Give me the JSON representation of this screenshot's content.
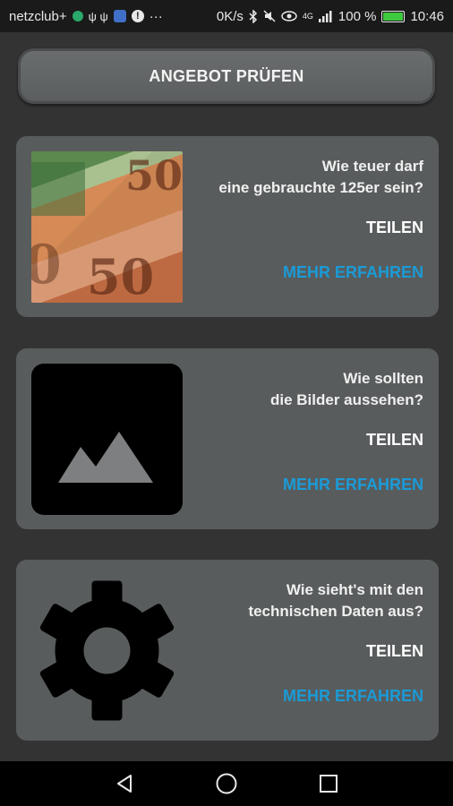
{
  "status_bar": {
    "carrier": "netzclub+",
    "usb_glyphs": "ψ ψ",
    "more": "···",
    "speed": "0K/s",
    "signal_text": "4G",
    "battery": "100 %",
    "battery_level": 1.0,
    "time": "10:46"
  },
  "check_button": {
    "label": "ANGEBOT PRÜFEN"
  },
  "cards": [
    {
      "question": "Wie teuer darf\neine gebrauchte 125er sein?",
      "share": "TEILEN",
      "more": "MEHR ERFAHREN",
      "media_icon": "money-photo"
    },
    {
      "question": "Wie sollten\ndie Bilder aussehen?",
      "share": "TEILEN",
      "more": "MEHR ERFAHREN",
      "media_icon": "image-placeholder-icon"
    },
    {
      "question": "Wie sieht's mit den\ntechnischen Daten aus?",
      "share": "TEILEN",
      "more": "MEHR ERFAHREN",
      "media_icon": "gear-icon"
    }
  ],
  "colors": {
    "background": "#333333",
    "card": "#595c5d",
    "accent": "#1a9bd7"
  }
}
